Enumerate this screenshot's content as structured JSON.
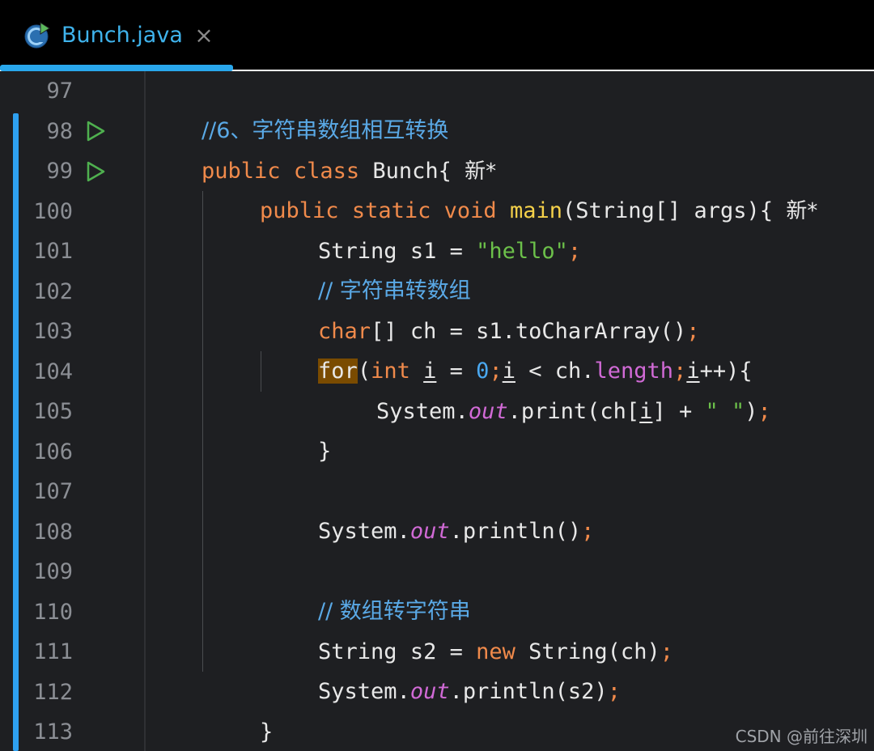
{
  "tab": {
    "title": "Bunch.java",
    "close": "×",
    "icon": "java-class-icon"
  },
  "line_numbers": [
    "97",
    "98",
    "99",
    "100",
    "101",
    "102",
    "103",
    "104",
    "105",
    "106",
    "107",
    "108",
    "109",
    "110",
    "111",
    "112",
    "113"
  ],
  "code": {
    "l97_comment": "//6、字符串数组相互转换",
    "l98_public": "public",
    "l98_class": "class",
    "l98_name": " Bunch{ ",
    "l98_new": "新*",
    "l99_public": "public",
    "l99_static": "static",
    "l99_void": "void",
    "l99_main": "main",
    "l99_rest": "(String[] args){ ",
    "l99_new": "新*",
    "l100_type": "String s1 = ",
    "l100_str": "\"hello\"",
    "l100_semi": ";",
    "l101_comment": "// 字符串转数组",
    "l102_kw": "char",
    "l102_rest": "[] ch = s1.toCharArray()",
    "l102_semi": ";",
    "l103_for": "for",
    "l103_open": "(",
    "l103_int": "int",
    "l103_sp": " ",
    "l103_i1": "i",
    "l103_eq": " = ",
    "l103_zero": "0",
    "l103_semi1": ";",
    "l103_i2": "i",
    "l103_lt": " < ch.",
    "l103_length": "length",
    "l103_semi2": ";",
    "l103_i3": "i",
    "l103_end": "++){",
    "l104_sys": "System.",
    "l104_out": "out",
    "l104_print": ".print(ch[",
    "l104_i": "i",
    "l104_plus": "] + ",
    "l104_str": "\" \"",
    "l104_close": ")",
    "l104_semi": ";",
    "l105": "}",
    "l107_sys": "System.",
    "l107_out": "out",
    "l107_rest": ".println()",
    "l107_semi": ";",
    "l109_comment": "// 数组转字符串",
    "l110_type": "String s2 = ",
    "l110_new": "new",
    "l110_rest": " String(ch)",
    "l110_semi": ";",
    "l111_sys": "System.",
    "l111_out": "out",
    "l111_rest": ".println(s2)",
    "l111_semi": ";",
    "l112": "}",
    "l113": "}"
  },
  "run_icons": [
    "run-gutter-icon",
    "run-gutter-icon"
  ],
  "watermark": "CSDN @前往深圳",
  "colors": {
    "tab_text": "#3fb3ec",
    "tab_underline": "#29a7ec",
    "change_bar": "#2ea0f0",
    "keyword": "#f08a4b",
    "string": "#6cc04a",
    "comment": "#5aa9e6",
    "number": "#4aa8f0",
    "field": "#d16ad6",
    "method": "#f5d14a",
    "highlight": "#7a4b00"
  }
}
